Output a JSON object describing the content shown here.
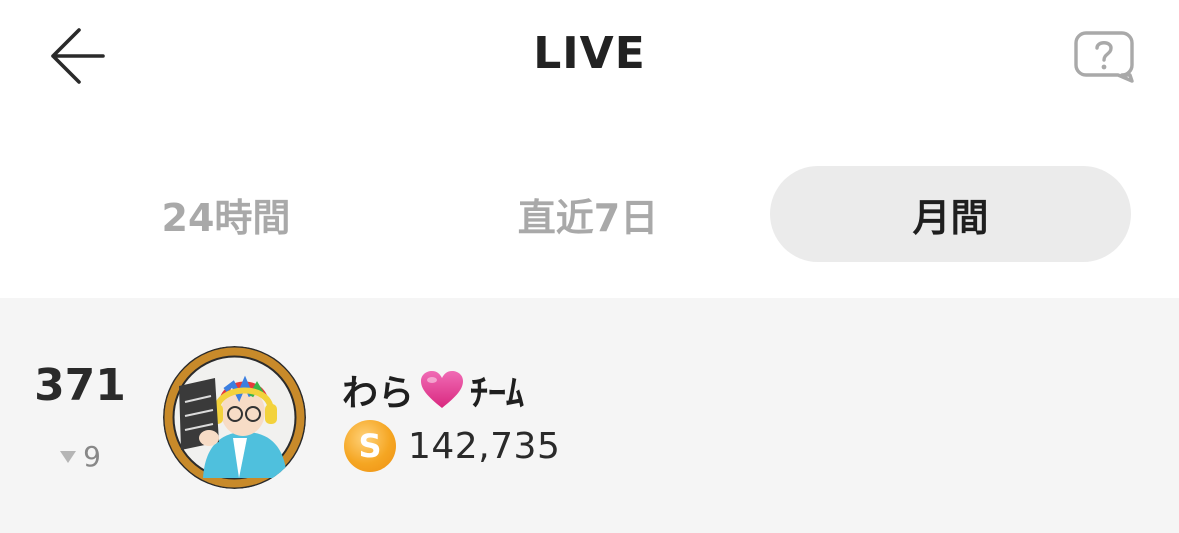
{
  "header": {
    "title": "LIVE",
    "back_icon": "arrow-left-icon",
    "help_icon": "question-bubble-icon"
  },
  "tabs": [
    {
      "label": "24時間",
      "active": false
    },
    {
      "label": "直近7日",
      "active": false
    },
    {
      "label": "月間",
      "active": true
    }
  ],
  "ranking": [
    {
      "rank": "371",
      "change_direction": "down",
      "change": "9",
      "name_prefix": "わら",
      "name_emoji": "💗",
      "name_suffix": "ﾁｰﾑ",
      "coin_symbol": "S",
      "score": "142,735"
    }
  ],
  "colors": {
    "accent_coin": "#f5a623",
    "active_tab_bg": "#ebebeb",
    "list_bg": "#f5f5f5",
    "heart": "#e8469a"
  }
}
